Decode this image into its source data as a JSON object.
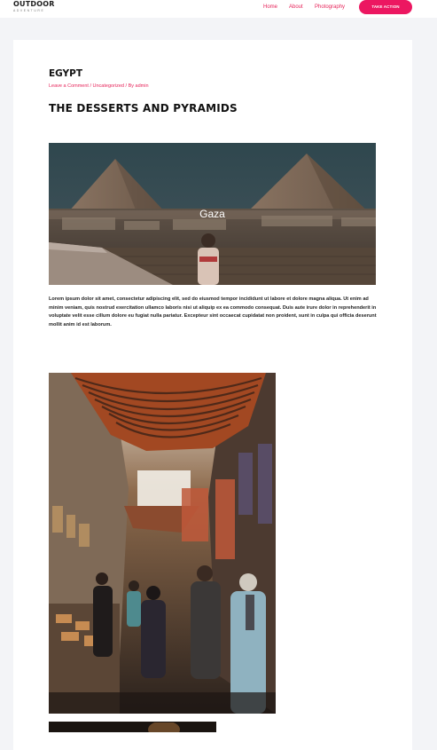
{
  "header": {
    "logo_main": "OUTDOOR",
    "logo_sub": "ADVENTURE",
    "nav": [
      "Home",
      "About",
      "Photography"
    ],
    "cta_label": "TAKE ACTION"
  },
  "post": {
    "category_title": "EGYPT",
    "meta": "Leave a Comment / Uncategorized / By admin",
    "title": "THE DESSERTS AND PYRAMIDS",
    "hero_caption": "Gaza",
    "body": "Lorem ipsum dolor sit amet, consectetur adipiscing elit, sed do eiusmod tempor incididunt ut labore et dolore magna aliqua. Ut enim ad minim veniam, quis nostrud exercitation ullamco laboris nisi ut aliquip ex ea commodo consequat. Duis aute irure dolor in reprehenderit in voluptate velit esse cillum dolore eu fugiat nulla pariatur. Excepteur sint occaecat cupidatat non proident, sunt in culpa qui officia deserunt mollit anim id est laborum."
  },
  "colors": {
    "accent": "#ec1761",
    "link": "#e6245a",
    "page_bg": "#f3f4f7",
    "card_bg": "#ffffff"
  }
}
